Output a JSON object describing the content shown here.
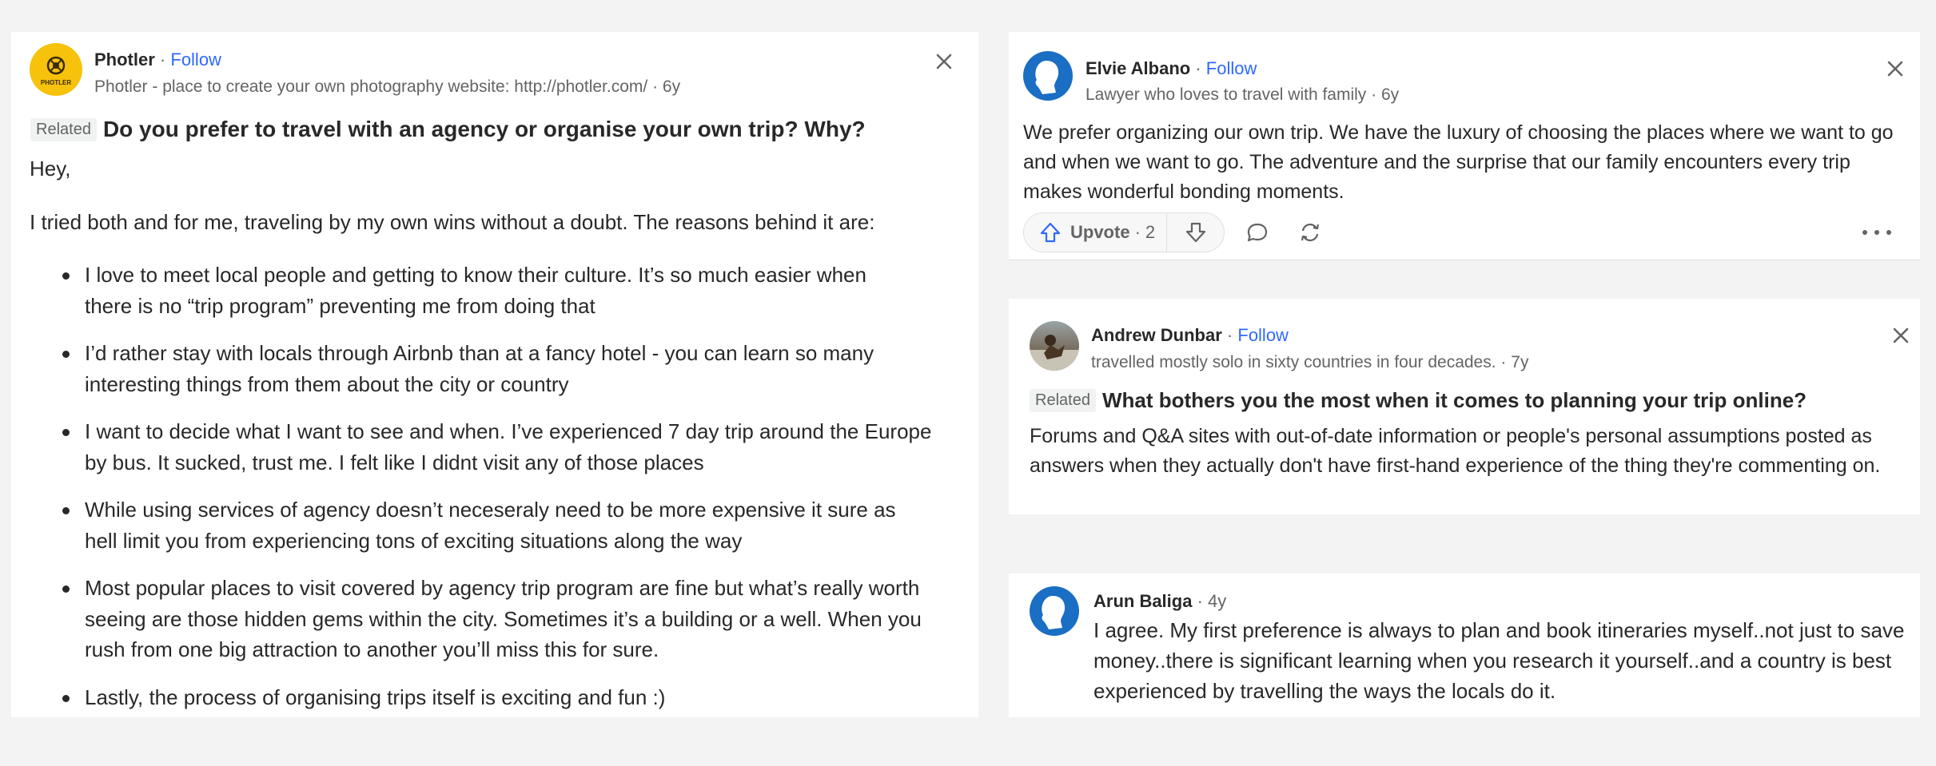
{
  "left_answer": {
    "author": "Photler",
    "follow": "Follow",
    "credential": "Photler - place to create your own photography website: http://photler.com/",
    "time": "6y",
    "logo_text": "PHOTLER",
    "related_label": "Related",
    "question": "Do you prefer to travel with an agency or organise your own trip? Why?",
    "greeting": "Hey,",
    "intro": "I tried both and for me, traveling by my own wins without a doubt. The reasons behind it are:",
    "bullets": [
      "I love to meet local people and getting to know their culture. It’s so much easier when there is no “trip program” preventing me from doing that",
      "I’d rather stay with locals through Airbnb than at a fancy hotel - you can learn so many interesting things from them about the city or country",
      "I want to decide what I want to see and when. I’ve experienced 7 day trip around the Europe by bus. It sucked, trust me. I felt like I didnt visit any of those places",
      "While using services of agency doesn’t neceseraly need to be more expensive it sure as hell limit you from experiencing tons of exciting situations along the way",
      "Most popular places to visit covered by agency trip program are fine but what’s really worth seeing are those hidden gems within the city. Sometimes it’s a building or a well. When you rush from one big attraction to another you’ll miss this for sure.",
      "Lastly, the process of organising trips itself is exciting and fun :)"
    ]
  },
  "elvie_answer": {
    "author": "Elvie Albano",
    "follow": "Follow",
    "credential": "Lawyer who loves to travel with family",
    "time": "6y",
    "text": "We prefer organizing our own trip. We have the luxury of choosing the places where we want to go and when we want to go. The adventure and the surprise that our family encounters every trip makes wonderful bonding moments.",
    "upvote_label": "Upvote",
    "upvote_count": "2"
  },
  "andrew_answer": {
    "author": "Andrew Dunbar",
    "follow": "Follow",
    "credential": "travelled mostly solo in sixty countries in four decades.",
    "time": "7y",
    "related_label": "Related",
    "question": "What bothers you the most when it comes to planning your trip online?",
    "text": "Forums and Q&A sites with out-of-date information or people's personal assumptions posted as answers when they actually don't have first-hand experience of the thing they're commenting on."
  },
  "arun_comment": {
    "author": "Arun Baliga",
    "time": "4y",
    "text": "I agree. My first preference is always to plan and book itineraries myself..not just to save money..there is significant learning when you research it yourself..and a country is best experienced by travelling the ways the locals do it."
  },
  "colors": {
    "accent_blue": "#2e69ff",
    "avatar_blue": "#1a6ec4",
    "logo_yellow": "#f7c20c",
    "text_primary": "#282829",
    "text_secondary": "#636466"
  },
  "icons": [
    "close-icon",
    "upvote-icon",
    "downvote-icon",
    "comment-icon",
    "share-icon",
    "more-icon"
  ]
}
